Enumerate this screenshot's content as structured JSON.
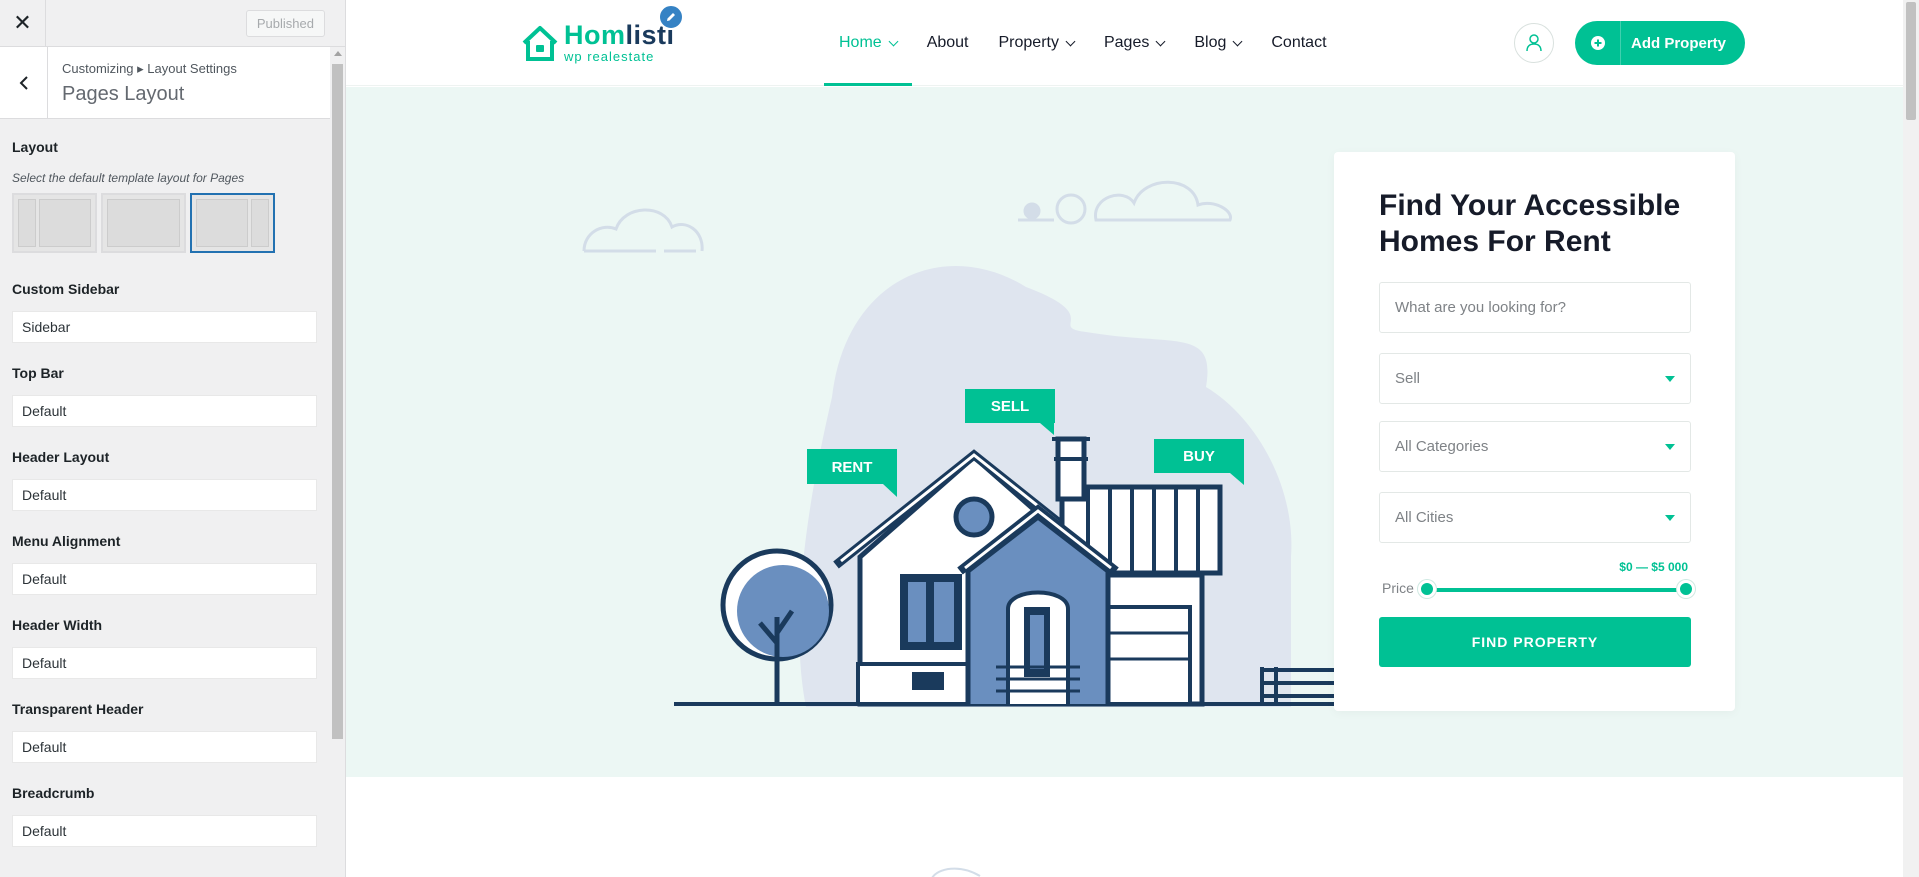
{
  "customizer": {
    "published_label": "Published",
    "breadcrumb": "Customizing ▸ Layout Settings",
    "panel_title": "Pages Layout",
    "layout": {
      "label": "Layout",
      "description": "Select the default template layout for Pages",
      "options": [
        "left-sidebar",
        "full-width",
        "right-sidebar"
      ],
      "selected": "right-sidebar"
    },
    "fields": [
      {
        "label": "Custom Sidebar",
        "value": "Sidebar"
      },
      {
        "label": "Top Bar",
        "value": "Default"
      },
      {
        "label": "Header Layout",
        "value": "Default"
      },
      {
        "label": "Menu Alignment",
        "value": "Default"
      },
      {
        "label": "Header Width",
        "value": "Default"
      },
      {
        "label": "Transparent Header",
        "value": "Default"
      },
      {
        "label": "Breadcrumb",
        "value": "Default"
      }
    ]
  },
  "site": {
    "logo": {
      "name_part1": "Hom",
      "name_part2": "listi",
      "tagline": "wp realestate"
    },
    "nav": [
      {
        "label": "Home",
        "has_dropdown": true,
        "active": true
      },
      {
        "label": "About",
        "has_dropdown": false,
        "active": false
      },
      {
        "label": "Property",
        "has_dropdown": true,
        "active": false
      },
      {
        "label": "Pages",
        "has_dropdown": true,
        "active": false
      },
      {
        "label": "Blog",
        "has_dropdown": true,
        "active": false
      },
      {
        "label": "Contact",
        "has_dropdown": false,
        "active": false
      }
    ],
    "add_property_label": "Add Property",
    "accent_color": "#00c194",
    "navy_color": "#1a3a5c"
  },
  "hero": {
    "tags": {
      "rent": "RENT",
      "sell": "SELL",
      "buy": "BUY"
    },
    "search": {
      "title": "Find Your Accessible Homes For Rent",
      "keyword_placeholder": "What are you looking for?",
      "type_select": "Sell",
      "category_select": "All Categories",
      "city_select": "All Cities",
      "price_label": "Price",
      "price_range": "$0 — $5 000",
      "price_min_fraction": 0,
      "price_max_fraction": 1,
      "submit_label": "FIND PROPERTY"
    }
  }
}
